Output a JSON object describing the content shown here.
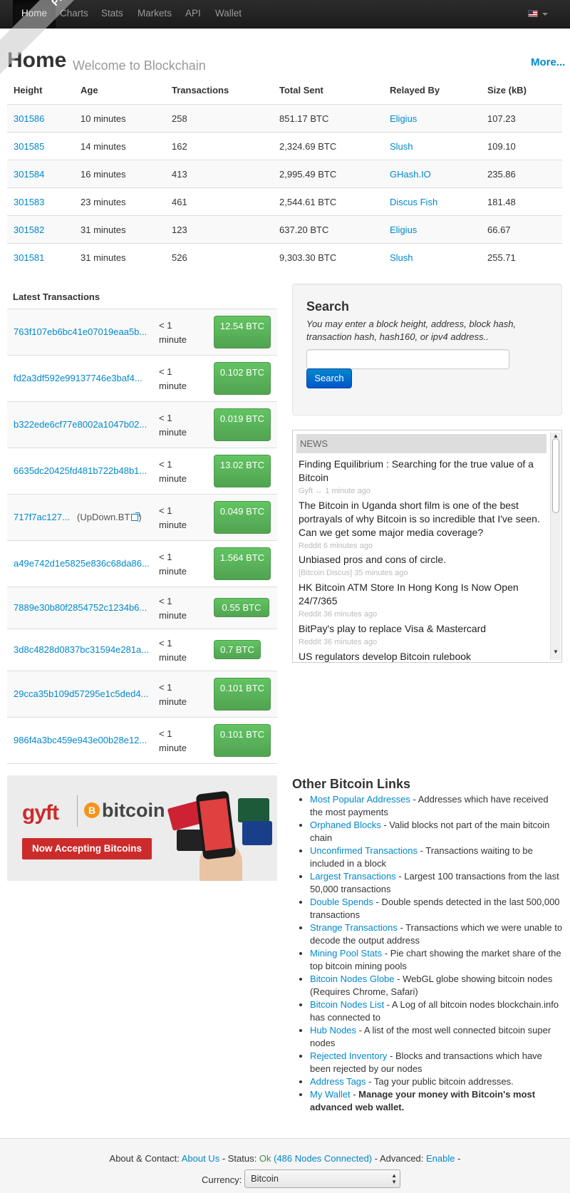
{
  "nav": {
    "items": [
      "Home",
      "Charts",
      "Stats",
      "Markets",
      "API",
      "Wallet"
    ]
  },
  "header": {
    "title": "Home",
    "subtitle": "Welcome to Blockchain",
    "more": "More..."
  },
  "blocks": {
    "columns": [
      "Height",
      "Age",
      "Transactions",
      "Total Sent",
      "Relayed By",
      "Size (kB)"
    ],
    "rows": [
      {
        "height": "301586",
        "age": "10 minutes",
        "transactions": "258",
        "total_sent": "851.17 BTC",
        "relayed_by": "Eligius",
        "size": "107.23"
      },
      {
        "height": "301585",
        "age": "14 minutes",
        "transactions": "162",
        "total_sent": "2,324.69 BTC",
        "relayed_by": "Slush",
        "size": "109.10"
      },
      {
        "height": "301584",
        "age": "16 minutes",
        "transactions": "413",
        "total_sent": "2,995.49 BTC",
        "relayed_by": "GHash.IO",
        "size": "235.86"
      },
      {
        "height": "301583",
        "age": "23 minutes",
        "transactions": "461",
        "total_sent": "2,544.61 BTC",
        "relayed_by": "Discus Fish",
        "size": "181.48"
      },
      {
        "height": "301582",
        "age": "31 minutes",
        "transactions": "123",
        "total_sent": "637.20 BTC",
        "relayed_by": "Eligius",
        "size": "66.67"
      },
      {
        "height": "301581",
        "age": "31 minutes",
        "transactions": "526",
        "total_sent": "9,303.30 BTC",
        "relayed_by": "Slush",
        "size": "255.71"
      }
    ]
  },
  "latest_transactions": {
    "title": "Latest Transactions",
    "rows": [
      {
        "hash": "763f107eb6bc41e07019eaa5b...",
        "tag": "",
        "time": "< 1 minute",
        "amount": "12.54 BTC"
      },
      {
        "hash": "fd2a3df592e99137746e3baf4...",
        "tag": "",
        "time": "< 1 minute",
        "amount": "0.102 BTC"
      },
      {
        "hash": "b322ede6cf77e8002a1047b02...",
        "tag": "",
        "time": "< 1 minute",
        "amount": "0.019 BTC"
      },
      {
        "hash": "6635dc20425fd481b722b48b1...",
        "tag": "",
        "time": "< 1 minute",
        "amount": "13.02 BTC"
      },
      {
        "hash": "717f7ac127...",
        "tag": "(UpDown.BT",
        "tag_close": ")",
        "time": "< 1 minute",
        "amount": "0.049 BTC"
      },
      {
        "hash": "a49e742d1e5825e836c68da86...",
        "tag": "",
        "time": "< 1 minute",
        "amount": "1.564 BTC"
      },
      {
        "hash": "7889e30b80f2854752c1234b6...",
        "tag": "",
        "time": "< 1 minute",
        "amount": "0.55 BTC"
      },
      {
        "hash": "3d8c4828d0837bc31594e281a...",
        "tag": "",
        "time": "< 1 minute",
        "amount": "0.7 BTC"
      },
      {
        "hash": "29cca35b109d57295e1c5ded4...",
        "tag": "",
        "time": "< 1 minute",
        "amount": "0.101 BTC"
      },
      {
        "hash": "986f4a3bc459e943e00b28e12...",
        "tag": "",
        "time": "< 1 minute",
        "amount": "0.101 BTC"
      }
    ]
  },
  "search": {
    "title": "Search",
    "hint": "You may enter a block height, address, block hash, transaction hash, hash160, or ipv4 address..",
    "input_value": "",
    "button": "Search"
  },
  "news": {
    "header": "NEWS",
    "items": [
      {
        "title": "Finding Equilibrium : Searching for the true value of a Bitcoin",
        "meta": "Gyft ← 1 minute ago"
      },
      {
        "title": "The Bitcoin in Uganda short film is one of the best portrayals of why Bitcoin is so incredible that I've seen. Can we get some major media coverage?",
        "meta": "Reddit 6 minutes ago"
      },
      {
        "title": "Unbiased pros and cons of circle.",
        "meta": "[Bitcoin Discus] 35 minutes ago"
      },
      {
        "title": "HK Bitcoin ATM Store In Hong Kong Is Now Open 24/7/365",
        "meta": "Reddit 36 minutes ago"
      },
      {
        "title": "BitPay's play to replace Visa & Mastercard",
        "meta": "Reddit 36 minutes ago"
      },
      {
        "title": "US regulators develop Bitcoin rulebook",
        "meta": ""
      }
    ]
  },
  "ad": {
    "brand": "gyft",
    "bitcoin_symbol": "B",
    "bitcoin_word": "bitcoin",
    "cta": "Now Accepting Bitcoins"
  },
  "other_links": {
    "title": "Other Bitcoin Links",
    "items": [
      {
        "link": "Most Popular Addresses",
        "desc": " - Addresses which have received the most payments"
      },
      {
        "link": "Orphaned Blocks",
        "desc": " - Valid blocks not part of the main bitcoin chain"
      },
      {
        "link": "Unconfirmed Transactions",
        "desc": " - Transactions waiting to be included in a block"
      },
      {
        "link": "Largest Transactions",
        "desc": " - Largest 100 transactions from the last 50,000 transactions"
      },
      {
        "link": "Double Spends",
        "desc": " - Double spends detected in the last 500,000 transactions"
      },
      {
        "link": "Strange Transactions",
        "desc": " - Transactions which we were unable to decode the output address"
      },
      {
        "link": "Mining Pool Stats",
        "desc": " - Pie chart showing the market share of the top bitcoin mining pools"
      },
      {
        "link": "Bitcoin Nodes Globe",
        "desc": " - WebGL globe showing bitcoin nodes (Requires Chrome, Safari)"
      },
      {
        "link": "Bitcoin Nodes List",
        "desc": " - A Log of all bitcoin nodes blockchain.info has connected to"
      },
      {
        "link": "Hub Nodes",
        "desc": " - A list of the most well connected bitcoin super nodes"
      },
      {
        "link": "Rejected Inventory",
        "desc": " - Blocks and transactions which have been rejected by our nodes"
      },
      {
        "link": "Address Tags",
        "desc": " - Tag your public bitcoin addresses."
      },
      {
        "link": "My Wallet",
        "desc": " - ",
        "bold": "Manage your money with Bitcoin's most advanced web wallet."
      }
    ]
  },
  "footer": {
    "about_prefix": "About & Contact: ",
    "about_link": "About Us",
    "status_prefix": " - Status: ",
    "status_ok": "Ok",
    "nodes_link": "(486 Nodes Connected)",
    "advanced_prefix": " - Advanced: ",
    "advanced_link": "Enable",
    "advanced_suffix": " -",
    "currency_label": "Currency:",
    "currency_value": "Bitcoin"
  },
  "watermark": "PhishTank"
}
